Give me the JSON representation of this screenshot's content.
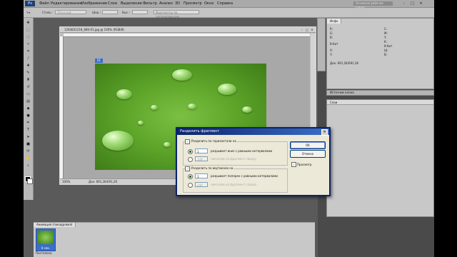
{
  "menubar": {
    "logo": "Ps",
    "items": [
      "Файл",
      "Редактирование",
      "Изображение",
      "Слои",
      "Выделение",
      "Фильтр",
      "Анализ",
      "3D",
      "Просмотр",
      "Окно",
      "Справка"
    ],
    "workspace": "Основная рабочая среда",
    "window_controls": [
      "–",
      "□",
      "✕"
    ]
  },
  "options": {
    "style_label": "Стиль:",
    "style_value": "Обычный",
    "width_label": "Шир.:",
    "height_label": "Выс.:",
    "guides_button": "Фрагменты по направляющим"
  },
  "document": {
    "title": "1283831218_680-01.jpg @ 100% (RGB/8)",
    "slice_tag": "01",
    "status_zoom": "100%",
    "status_doc": "Док: 691,2K/691,2K"
  },
  "info_panel": {
    "tab": "Инфо",
    "rows": [
      "R:",
      "G:",
      "B:",
      "8-бит",
      "X:",
      "Y:",
      "C:",
      "M:",
      "Y:",
      "K:",
      "8-бит",
      "Ш:",
      "В:",
      "Док: 691,2K/691,2K"
    ]
  },
  "panel2": {
    "label": "Источник клона"
  },
  "panel3": {
    "label": "Слои"
  },
  "animation": {
    "tab": "Анимация (покадровая)",
    "frame_duration": "0 сек.",
    "loop": "Постоянно"
  },
  "dialog": {
    "title": "Разделить фрагмент",
    "close": "✕",
    "horizontal": {
      "checkbox_label": "Разделить по горизонтали на",
      "value": "1",
      "option1_label": "разрывает вниз с равными интервалами",
      "px_value": "149",
      "option2_label": "пикселов на фрагмент сверху"
    },
    "vertical": {
      "checkbox_label": "Разделить по вертикали на",
      "value": "1",
      "option1_label": "разрывает поперек с равными интервалами",
      "px_value": "240",
      "option2_label": "пикселов на фрагмент справа"
    },
    "ok": "OK",
    "cancel": "Отмена",
    "preview_label": "Просмотр"
  },
  "colors": {
    "dialog_title": "#0a246a",
    "selection_blue": "#3a6ec9",
    "leaf_green": "#5ea62a"
  }
}
